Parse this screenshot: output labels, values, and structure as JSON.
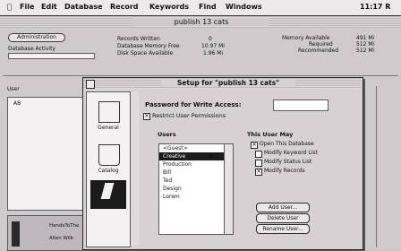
{
  "menubar": {
    "items": [
      "File",
      "Edit",
      "Database",
      "Record",
      "Keywords",
      "Find",
      "Windows"
    ],
    "clock": "11:17 R"
  },
  "document": {
    "title": "publish 13 cats",
    "admin_button": "Administration",
    "db_activity": "Database Activity",
    "stats_labels": [
      "Records Written",
      "Database Memory Free",
      "Disk Space Available"
    ],
    "stats_values": [
      "0",
      "10.97 Mi",
      "1.96 Mi"
    ],
    "mem_labels": [
      "Memory Available",
      "Required",
      "Recommended"
    ],
    "mem_values": [
      "491 Mi",
      "512 Mi",
      "512 Mi"
    ],
    "userlist_header": "User",
    "userlist_first": "AB",
    "bottom_rows": [
      "HandsToThe",
      "Allen Wilk"
    ]
  },
  "dialog": {
    "title": "Setup for \"publish 13 cats\"",
    "password_label": "Password for Write Access:",
    "restrict_label": "Restrict User Permissions",
    "users_header": "Users",
    "users": [
      "<Guest>",
      "Creative",
      "Production",
      "Bill",
      "Ted",
      "Design",
      "Lorem"
    ],
    "selected_user": 1,
    "this_user_may": "This User May",
    "permissions": [
      {
        "label": "Open This Database",
        "checked": true
      },
      {
        "label": "Modify Keyword List",
        "checked": false
      },
      {
        "label": "Modify Status List",
        "checked": false
      },
      {
        "label": "Modify Records",
        "checked": true
      }
    ],
    "buttons": [
      "Add User...",
      "Delete User",
      "Rename User..."
    ],
    "icons": [
      {
        "name": "general",
        "label": "General"
      },
      {
        "name": "catalog",
        "label": "Catalog"
      },
      {
        "name": "users",
        "label": ""
      }
    ]
  }
}
